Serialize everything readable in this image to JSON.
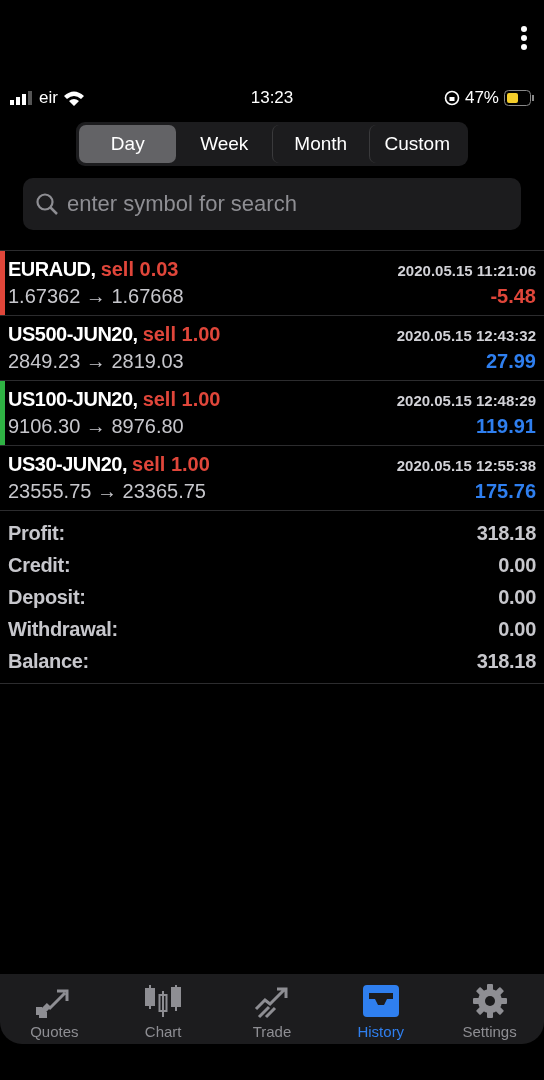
{
  "status_bar": {
    "carrier": "eir",
    "time": "13:23",
    "battery": "47%"
  },
  "periods": [
    {
      "label": "Day",
      "selected": true
    },
    {
      "label": "Week",
      "selected": false
    },
    {
      "label": "Month",
      "selected": false
    },
    {
      "label": "Custom",
      "selected": false
    }
  ],
  "search": {
    "placeholder": "enter symbol for search"
  },
  "deals": [
    {
      "symbol": "EURAUD,",
      "action": "sell 0.03",
      "time": "2020.05.15 11:21:06",
      "prices": "1.67362 → 1.67668",
      "result": "-5.48",
      "kind": "loss",
      "color": "#e0463a"
    },
    {
      "symbol": "US500-JUN20,",
      "action": "sell 1.00",
      "time": "2020.05.15 12:43:32",
      "prices": "2849.23 → 2819.03",
      "result": "27.99",
      "kind": "profit"
    },
    {
      "symbol": "US100-JUN20,",
      "action": "sell 1.00",
      "time": "2020.05.15 12:48:29",
      "prices": "9106.30 → 8976.80",
      "result": "119.91",
      "kind": "profit",
      "color": "#2fb344"
    },
    {
      "symbol": "US30-JUN20,",
      "action": "sell 1.00",
      "time": "2020.05.15 12:55:38",
      "prices": "23555.75 → 23365.75",
      "result": "175.76",
      "kind": "profit"
    }
  ],
  "summary": [
    {
      "label": "Profit:",
      "value": "318.18"
    },
    {
      "label": "Credit:",
      "value": "0.00"
    },
    {
      "label": "Deposit:",
      "value": "0.00"
    },
    {
      "label": "Withdrawal:",
      "value": "0.00"
    },
    {
      "label": "Balance:",
      "value": "318.18"
    }
  ],
  "tab_bar": [
    {
      "label": "Quotes",
      "kind": "quotes",
      "selected": false
    },
    {
      "label": "Chart",
      "kind": "chart",
      "selected": false
    },
    {
      "label": "Trade",
      "kind": "trade",
      "selected": false
    },
    {
      "label": "History",
      "kind": "history",
      "selected": true
    },
    {
      "label": "Settings",
      "kind": "settings",
      "selected": false
    }
  ]
}
